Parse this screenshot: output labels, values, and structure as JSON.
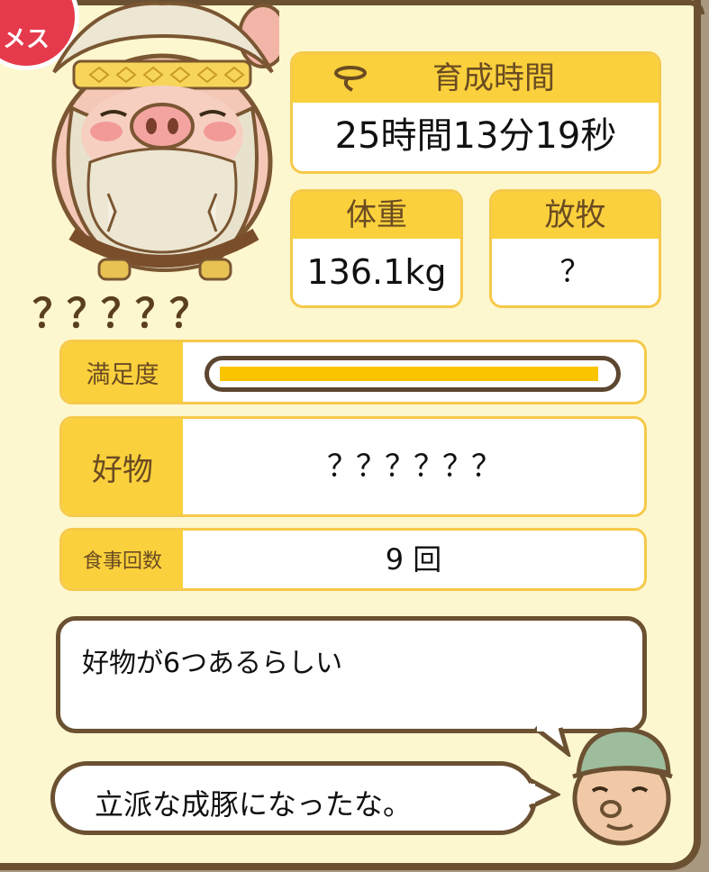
{
  "gender_badge": "メス",
  "pig_name": "？？？？？",
  "raise_time": {
    "label": "育成時間",
    "value": "25時間13分19秒"
  },
  "weight": {
    "label": "体重",
    "value": "136.1kg"
  },
  "pasture": {
    "label": "放牧",
    "value": "？"
  },
  "satisfaction": {
    "label": "満足度",
    "level": 1.0,
    "bar_color": "#fbc400"
  },
  "favorite": {
    "label": "好物",
    "value": "？？？？？？"
  },
  "meals": {
    "label": "食事回数",
    "value": "9 回"
  },
  "hint_text": "好物が6つあるらしい",
  "farmer_line": "立派な成豚になったな。",
  "colors": {
    "frame": "#6b5132",
    "panel": "#fdf7cf",
    "label_bg": "#fad03c",
    "label_text": "#6a4b22"
  }
}
